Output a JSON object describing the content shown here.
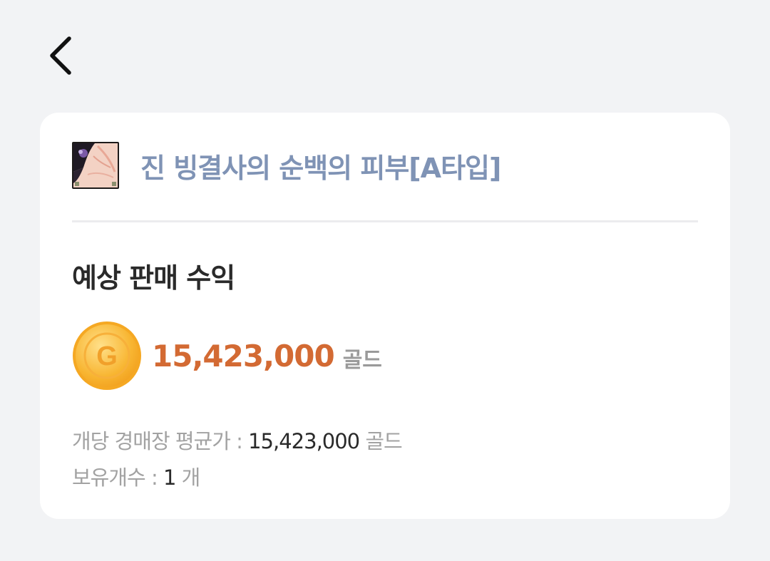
{
  "header": {
    "back_icon": "chevron-left-icon"
  },
  "item": {
    "name": "진 빙결사의 순백의 피부[A타입]",
    "icon": "item-thumbnail-icon"
  },
  "profit": {
    "title": "예상 판매 수익",
    "coin_icon": "gold-coin-icon",
    "coin_letter": "G",
    "value": "15,423,000",
    "unit": "골드"
  },
  "details": {
    "avg_label": "개당 경매장 평균가 : ",
    "avg_value": "15,423,000",
    "avg_unit": " 골드",
    "owned_label": "보유개수 : ",
    "owned_value": "1",
    "owned_unit": " 개"
  },
  "colors": {
    "background": "#f2f3f5",
    "card": "#ffffff",
    "item_name": "#7f93b5",
    "profit": "#d36a33",
    "muted": "#a2a2a2"
  }
}
